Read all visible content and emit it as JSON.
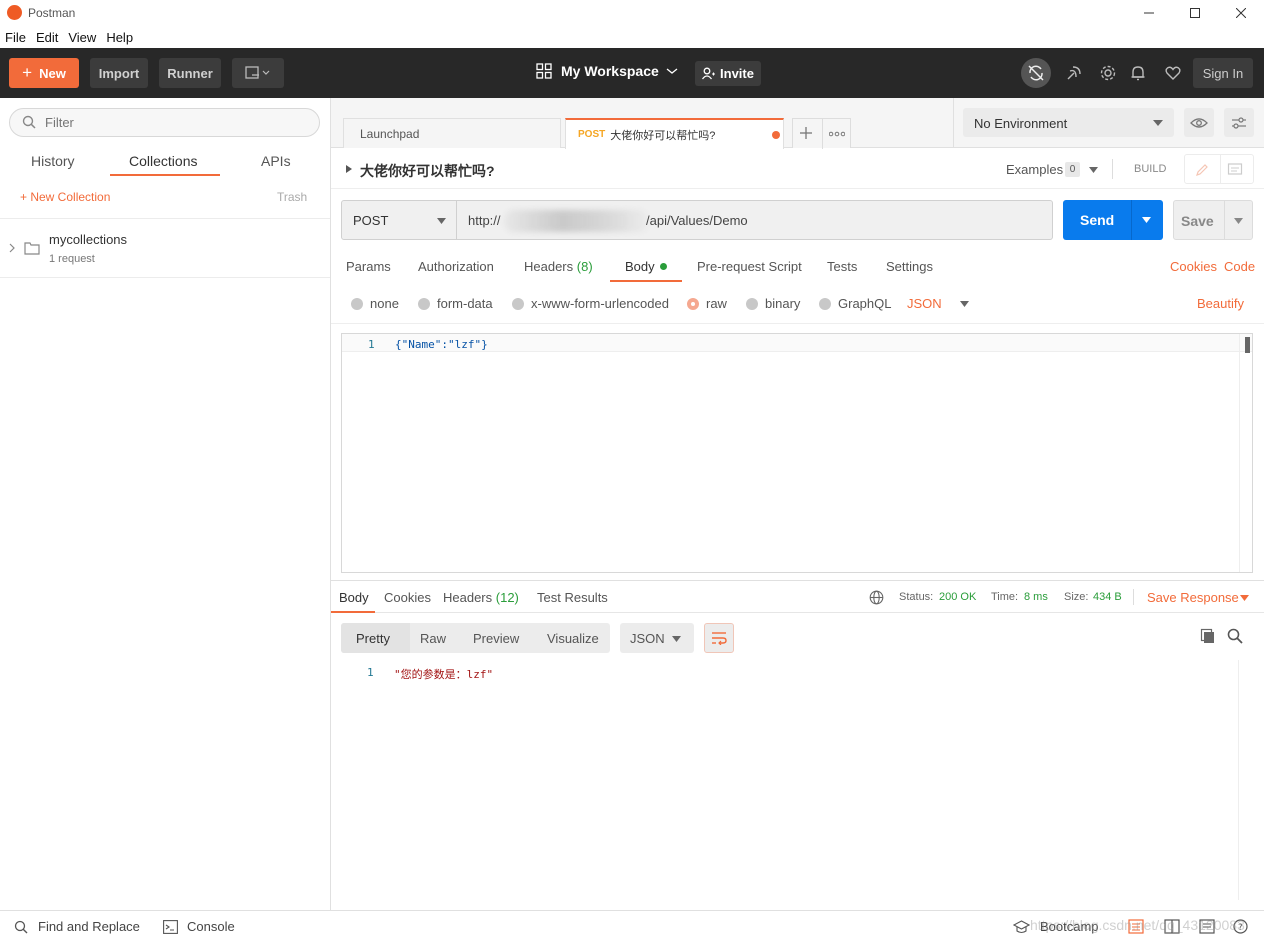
{
  "window": {
    "title": "Postman"
  },
  "menu": [
    "File",
    "Edit",
    "View",
    "Help"
  ],
  "header": {
    "new_label": "New",
    "import_label": "Import",
    "runner_label": "Runner",
    "workspace_label": "My Workspace",
    "invite_label": "Invite",
    "signin_label": "Sign In"
  },
  "sidebar": {
    "filter_placeholder": "Filter",
    "tabs": [
      "History",
      "Collections",
      "APIs"
    ],
    "active_tab": "Collections",
    "new_collection_label": "+ New Collection",
    "trash_label": "Trash",
    "collections": [
      {
        "name": "mycollections",
        "meta": "1 request"
      }
    ]
  },
  "tabs": {
    "items": [
      {
        "label": "Launchpad"
      },
      {
        "method": "POST",
        "label": "大佬你好可以帮忙吗?",
        "unsaved": true
      }
    ]
  },
  "environment": {
    "selected": "No Environment"
  },
  "request": {
    "name": "大佬你好可以帮忙吗?",
    "examples_label": "Examples",
    "examples_count": "0",
    "build_label": "BUILD",
    "method": "POST",
    "url_prefix": "http://",
    "url_suffix": "/api/Values/Demo",
    "send_label": "Send",
    "save_label": "Save",
    "subtabs": {
      "params": "Params",
      "authorization": "Authorization",
      "headers": "Headers",
      "headers_count": "(8)",
      "body": "Body",
      "prerequest": "Pre-request Script",
      "tests": "Tests",
      "settings": "Settings"
    },
    "cookies_link": "Cookies",
    "code_link": "Code",
    "body_types": [
      "none",
      "form-data",
      "x-www-form-urlencoded",
      "raw",
      "binary",
      "GraphQL"
    ],
    "body_type_selected": "raw",
    "body_format": "JSON",
    "beautify_label": "Beautify",
    "body_line_number": "1",
    "body_content": "{\"Name\":\"lzf\"}"
  },
  "response": {
    "tabs": {
      "body": "Body",
      "cookies": "Cookies",
      "headers": "Headers",
      "headers_count": "(12)",
      "test_results": "Test Results"
    },
    "status_label": "Status:",
    "status_value": "200 OK",
    "time_label": "Time:",
    "time_value": "8 ms",
    "size_label": "Size:",
    "size_value": "434 B",
    "save_response_label": "Save Response",
    "view_modes": [
      "Pretty",
      "Raw",
      "Preview",
      "Visualize"
    ],
    "active_view": "Pretty",
    "format": "JSON",
    "line_number": "1",
    "body_content": "\"您的参数是：lzf\""
  },
  "statusbar": {
    "find_replace_label": "Find and Replace",
    "console_label": "Console",
    "bootcamp_label": "Bootcamp",
    "watermark": "https://blog.csdn.net/qq_43120083"
  },
  "colors": {
    "accent": "#f26b3a",
    "send_blue": "#097bed",
    "header_bg": "#282828",
    "status_green": "#2a9d3a"
  }
}
